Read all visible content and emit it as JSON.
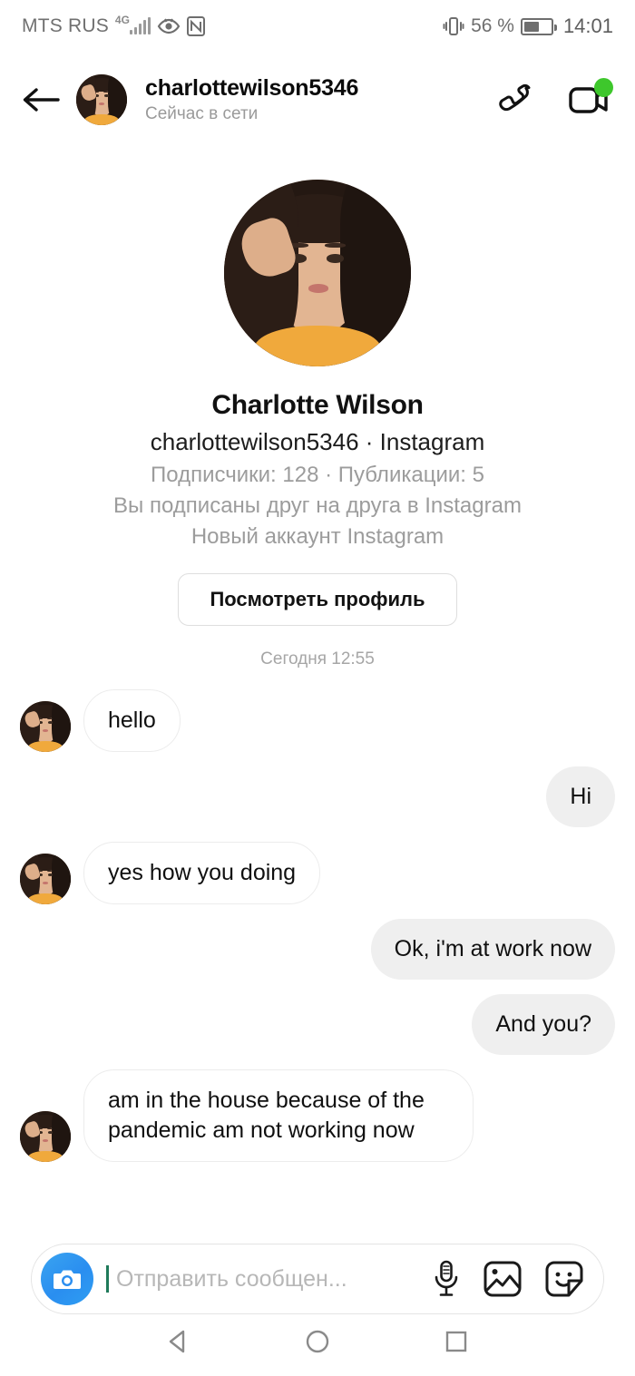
{
  "status_bar": {
    "carrier": "MTS RUS",
    "network": "4G",
    "battery_percent": "56 %",
    "time": "14:01",
    "icons": [
      "signal-bars-icon",
      "eye-icon",
      "nfc-icon",
      "vibrate-icon",
      "battery-icon"
    ]
  },
  "header": {
    "back_label": "back-arrow",
    "username": "charlottewilson5346",
    "online_status": "Сейчас в сети",
    "call_label": "audio-call",
    "video_label": "video-call",
    "has_unread_badge": true,
    "badge_color": "#3ec72c"
  },
  "profile": {
    "display_name": "Charlotte Wilson",
    "handle_line": "charlottewilson5346 · Instagram",
    "stats": "Подписчики: 128 · Публикации: 5",
    "mutual": "Вы подписаны друг на друга в Instagram",
    "new_account": "Новый аккаунт Instagram",
    "view_profile_button": "Посмотреть профиль",
    "followers_count": "128",
    "posts_count": "5"
  },
  "conversation": {
    "daystamp": "Сегодня 12:55",
    "messages": [
      {
        "text": "hello",
        "direction": "in"
      },
      {
        "text": "Hi",
        "direction": "out"
      },
      {
        "text": "yes how you doing",
        "direction": "in"
      },
      {
        "text": "Ok, i'm at work now",
        "direction": "out"
      },
      {
        "text": "And you?",
        "direction": "out"
      },
      {
        "text": "am in the house because of the pandemic am not working now",
        "direction": "in"
      }
    ]
  },
  "composer": {
    "placeholder": "Отправить сообщен...",
    "camera_label": "camera",
    "mic_label": "voice-message",
    "gallery_label": "gallery",
    "sticker_label": "sticker",
    "accent_color": "#2a8ef0"
  },
  "navbar": {
    "back": "back",
    "home": "home",
    "recents": "recents"
  },
  "theme": {
    "outgoing_bubble": "#efefef",
    "incoming_bubble": "#ffffff",
    "incoming_border": "#ececec",
    "muted_text": "#9c9c9c"
  }
}
